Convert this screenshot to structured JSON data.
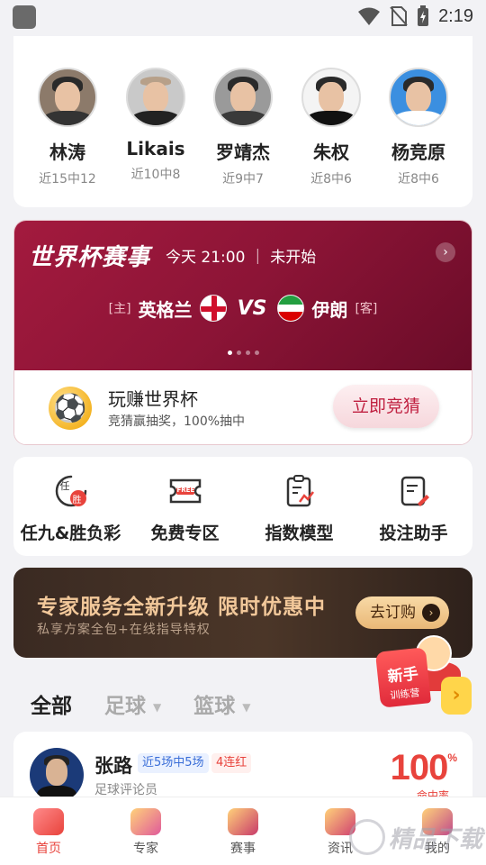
{
  "status_bar": {
    "time": "2:19"
  },
  "experts": [
    {
      "name": "林涛",
      "record": "近15中12"
    },
    {
      "name": "Likais",
      "record": "近10中8"
    },
    {
      "name": "罗靖杰",
      "record": "近9中7"
    },
    {
      "name": "朱权",
      "record": "近8中6"
    },
    {
      "name": "杨竞原",
      "record": "近8中6"
    }
  ],
  "worldcup": {
    "title": "世界杯赛事",
    "time": "今天 21:00 ｜ 未开始",
    "home_tag": "[主]",
    "home_team": "英格兰",
    "vs": "VS",
    "away_team": "伊朗",
    "away_tag": "[客]",
    "promo_title": "玩赚世界杯",
    "promo_sub": "竞猜赢抽奖，100%抽中",
    "promo_button": "立即竞猜"
  },
  "quick_menu": [
    {
      "label": "任九&胜负彩",
      "icon_text_top": "任",
      "icon_text_badge": "胜"
    },
    {
      "label": "免费专区",
      "icon_text": "FREE"
    },
    {
      "label": "指数模型"
    },
    {
      "label": "投注助手"
    }
  ],
  "vip_banner": {
    "title": "专家服务全新升级 限时优惠中",
    "subtitle": "私享方案全包+在线指导特权",
    "button": "去订购"
  },
  "newbie": {
    "line1": "新手",
    "line2": "训练营"
  },
  "tabs": [
    {
      "label": "全部",
      "active": true
    },
    {
      "label": "足球",
      "active": false
    },
    {
      "label": "篮球",
      "active": false
    }
  ],
  "list": [
    {
      "name": "张路",
      "streak": "近5场中5场",
      "badge": "4连红",
      "role": "足球评论员",
      "rate": "100",
      "rate_unit": "%",
      "rate_label": "命中率"
    }
  ],
  "bottom_nav": [
    {
      "label": "首页",
      "active": true
    },
    {
      "label": "专家",
      "active": false
    },
    {
      "label": "赛事",
      "active": false
    },
    {
      "label": "资讯",
      "active": false
    },
    {
      "label": "我的",
      "active": false
    }
  ],
  "watermark": "精品下载",
  "colors": {
    "accent": "#e8433c",
    "banner": "#8c1436",
    "vip_gold": "#f2c89a"
  }
}
